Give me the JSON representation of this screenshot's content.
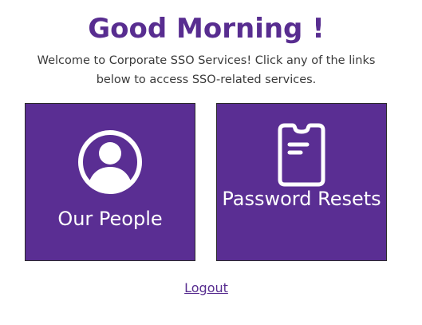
{
  "header": {
    "greeting": "Good Morning !",
    "welcome_text": "Welcome to Corporate SSO Services! Click any of the links below to access SSO-related services."
  },
  "tiles": [
    {
      "label": "Our People",
      "icon": "user-circle-icon"
    },
    {
      "label": "Password Resets",
      "icon": "phone-document-icon"
    }
  ],
  "footer": {
    "logout_label": "Logout"
  },
  "colors": {
    "brand_purple": "#5a2e93",
    "heading_purple": "#582d90",
    "text": "#3a3a3a",
    "tile_text": "#ffffff"
  }
}
